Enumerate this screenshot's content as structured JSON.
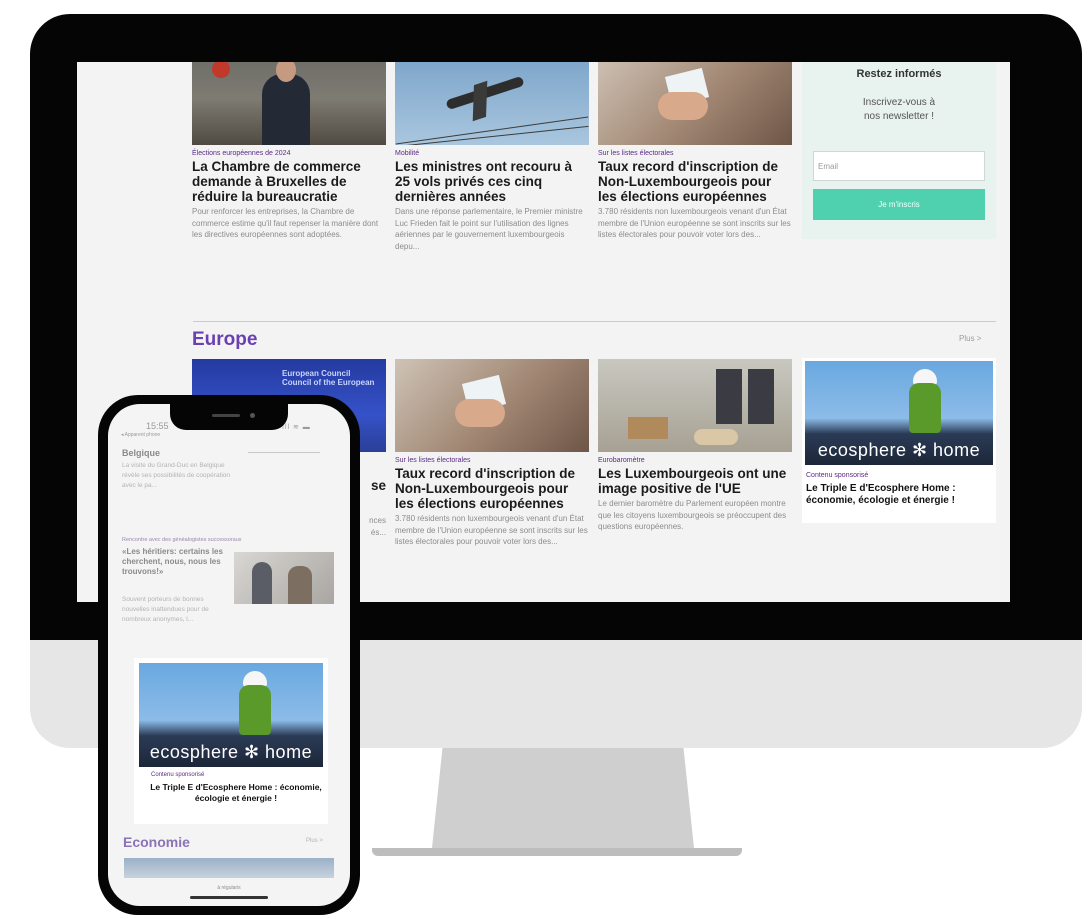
{
  "desktop": {
    "top_cards": [
      {
        "kicker": "Élections européennes de 2024",
        "title": "La Chambre de commerce demande à Bruxelles de réduire la bureaucratie",
        "excerpt": "Pour renforcer les entreprises, la Chambre de commerce estime qu'il faut repenser la manière dont les directives européennes sont adoptées."
      },
      {
        "kicker": "Mobilité",
        "title": "Les ministres ont recouru à 25 vols privés ces cinq dernières années",
        "excerpt": "Dans une réponse parlementaire, le Premier ministre Luc Frieden fait le point sur l'utilisation des lignes aériennes par le gouvernement luxembourgeois depu..."
      },
      {
        "kicker": "Sur les listes électorales",
        "title": "Taux record d'inscription de Non-Luxembourgeois pour les élections européennes",
        "excerpt": "3.780 résidents non luxembourgeois venant d'un État membre de l'Union européenne se sont inscrits sur les listes électorales pour pouvoir voter lors des..."
      }
    ],
    "newsletter": {
      "title": "Restez informés",
      "text": "Inscrivez-vous à\nnos newsletter !",
      "email_placeholder": "Email",
      "button": "Je m'inscris"
    },
    "section": {
      "title": "Europe",
      "more": "Plus >"
    },
    "europe_cards": [
      {
        "kicker": "",
        "title": "se",
        "excerpt": "nces\nés..."
      },
      {
        "kicker": "Sur les listes électorales",
        "title": "Taux record d'inscription de Non-Luxembourgeois pour les élections européennes",
        "excerpt": "3.780 résidents non luxembourgeois venant d'un État membre de l'Union européenne se sont inscrits sur les listes électorales pour pouvoir voter lors des..."
      },
      {
        "kicker": "Eurobaromètre",
        "title": "Les Luxembourgeois ont une image positive de l'UE",
        "excerpt": "Le dernier baromètre du Parlement européen montre que les citoyens luxembourgeois se préoccupent des questions européennes."
      }
    ],
    "eu_thumb_text": "European Council\nCouncil of the European",
    "ad": {
      "logo": "ecosphere ✻ home",
      "kicker": "Contenu sponsorisé",
      "title": "Le Triple E d'Ecosphere Home : économie, écologie et énergie !"
    }
  },
  "phone": {
    "time": "15:55",
    "sub": "◂ Apparent phone",
    "signal": "ıll ≋ ▬",
    "belgique": {
      "title": "Belgique",
      "text": "La visite du Grand-Duc en Belgique révèle ses possibilités de coopération avec le pa..."
    },
    "article": {
      "kicker": "Rencontre avec des généalogistes successoraux",
      "title": "«Les héritiers: certains les cherchent, nous, nous les trouvons!»",
      "excerpt": "Souvent porteurs de bonnes nouvelles inattendues pour de nombreux anonymes, l..."
    },
    "ad": {
      "logo": "ecosphere ✻ home",
      "kicker": "Contenu sponsorisé",
      "title": "Le Triple E d'Ecosphere Home : économie, écologie et énergie !"
    },
    "section": {
      "title": "Economie",
      "more": "Plus >"
    },
    "footer": "à régularis"
  },
  "colors": {
    "accent_purple": "#6a3fb4",
    "kicker_purple": "#5b2a86",
    "mint_button": "#4fd1b0",
    "mint_panel": "#e8f2ee"
  }
}
